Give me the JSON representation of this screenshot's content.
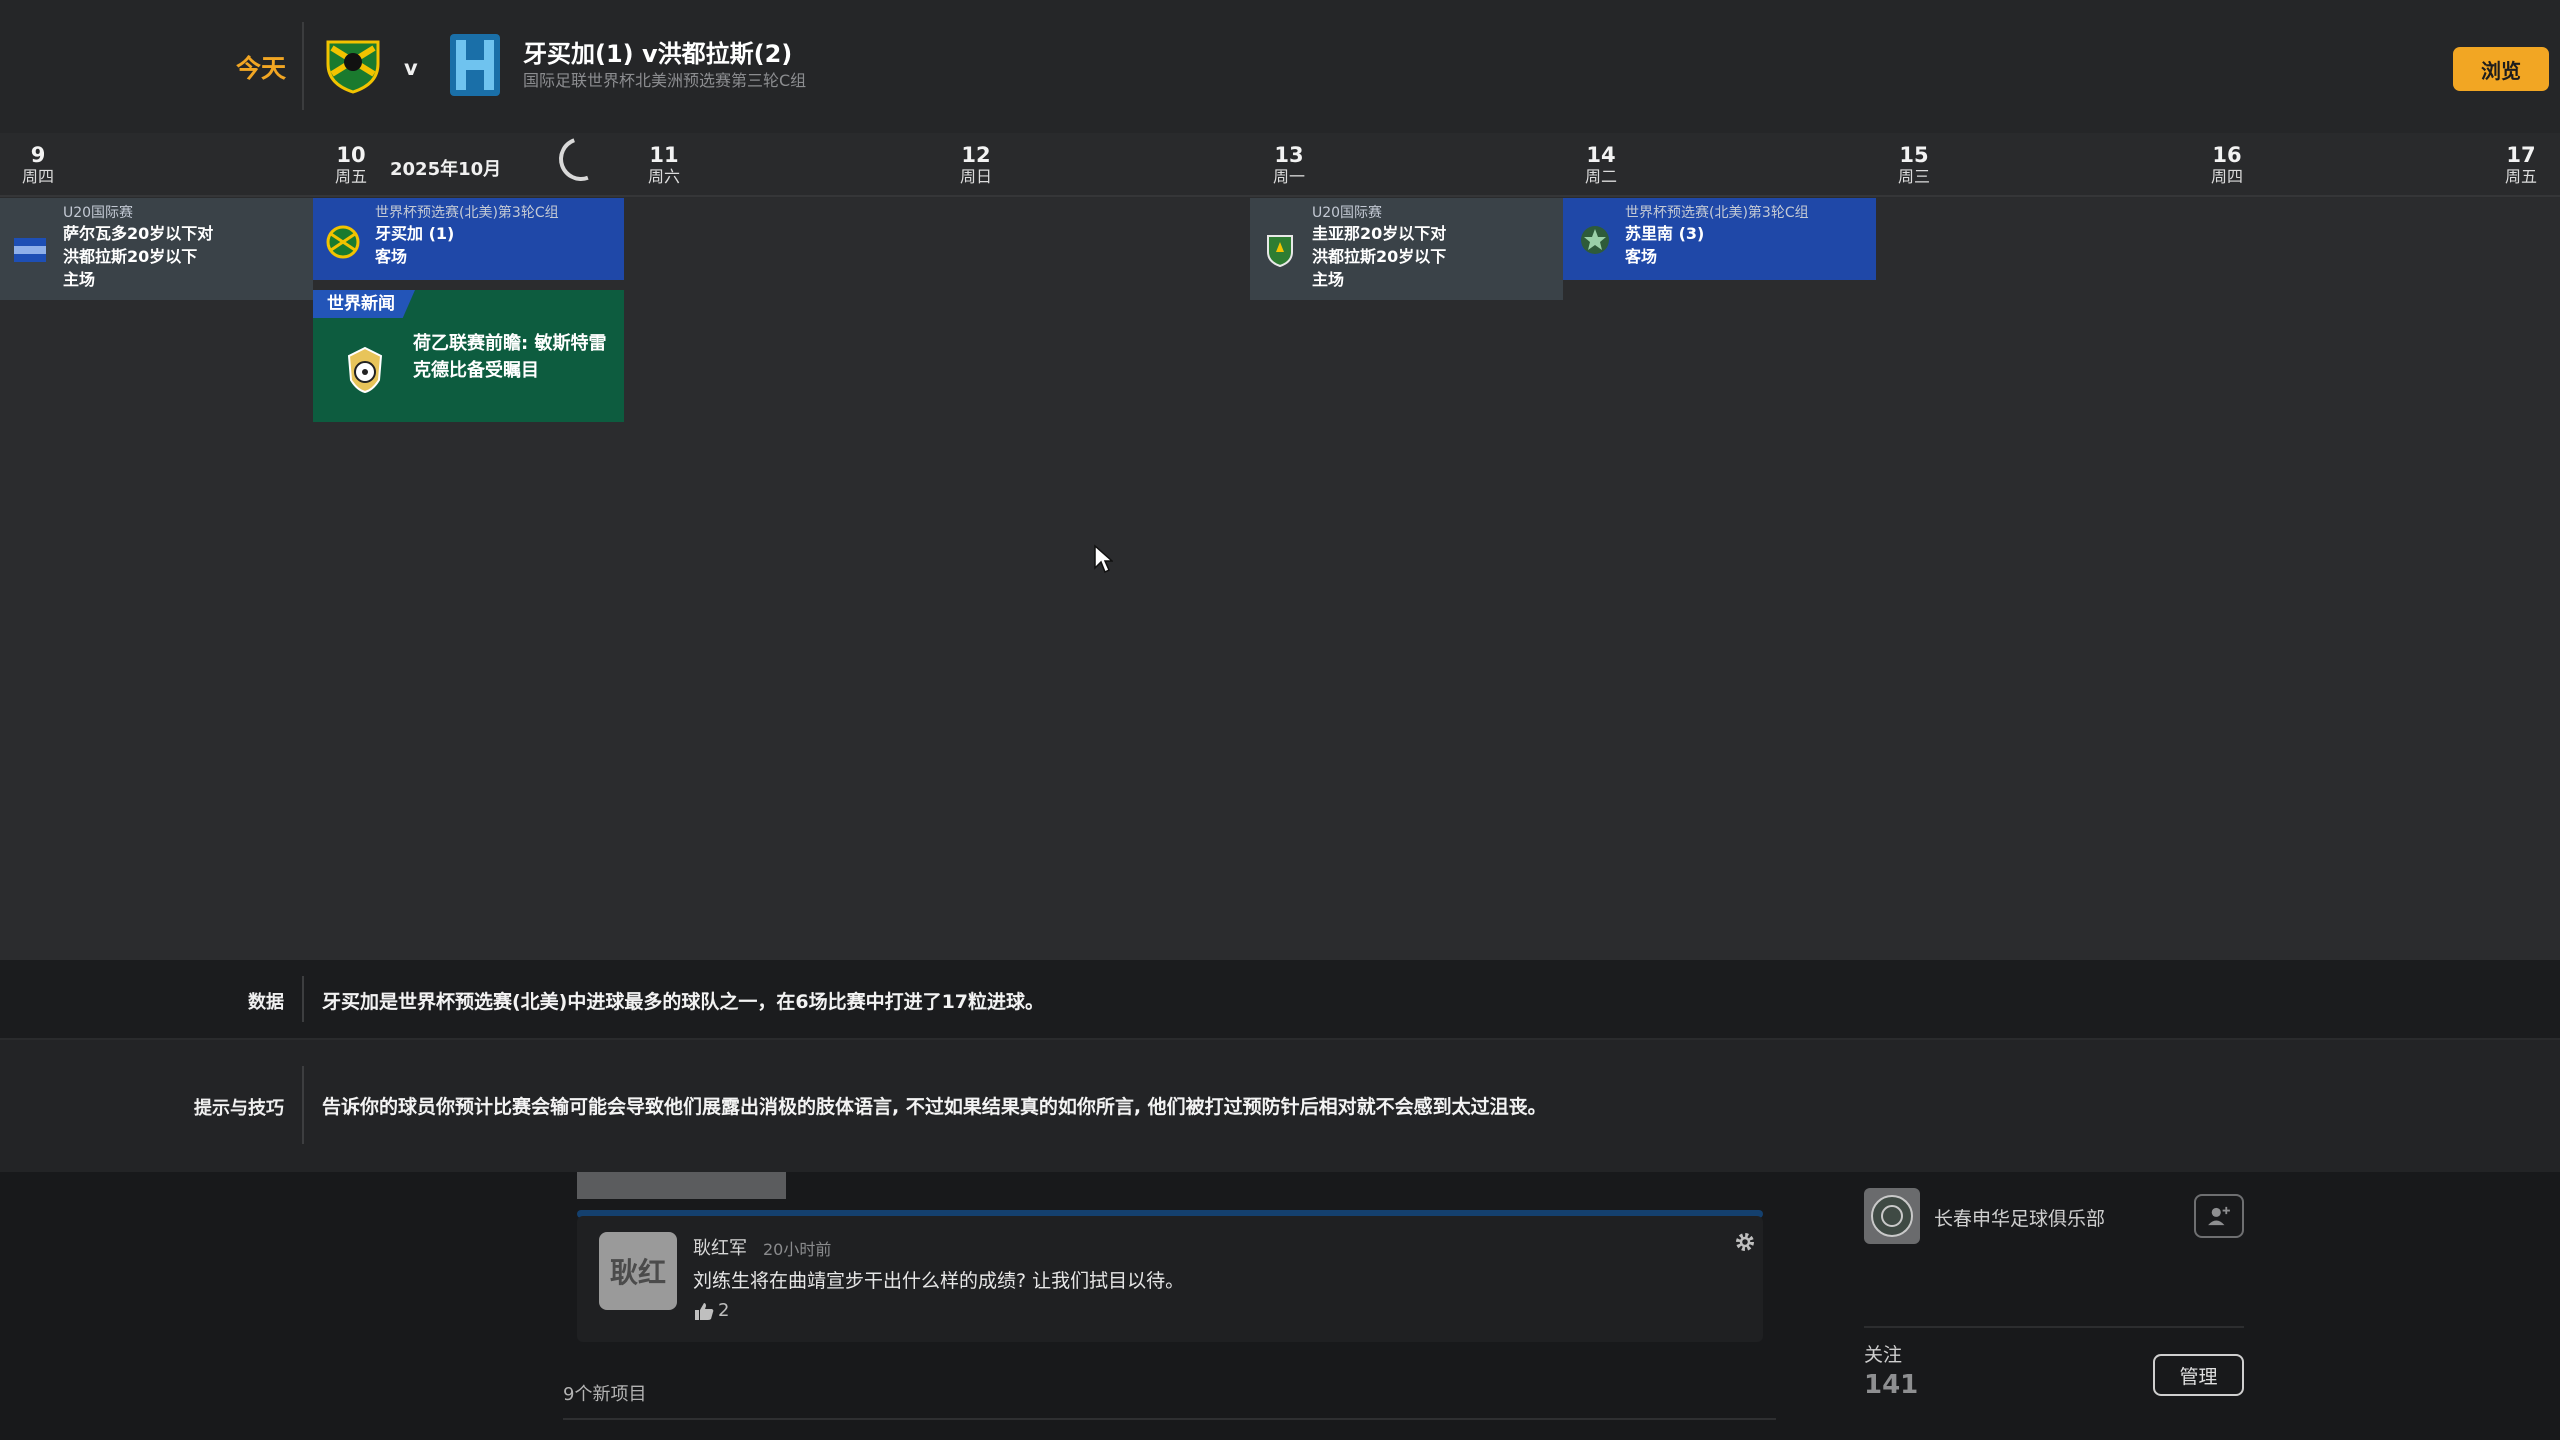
{
  "header": {
    "today_label": "今天",
    "vs": "v",
    "match_title": "牙买加(1) v洪都拉斯(2)",
    "match_subtitle": "国际足联世界杯北美洲预选赛第三轮C组",
    "browse_button": "浏览"
  },
  "calendar": {
    "month_label": "2025年10月",
    "days": [
      {
        "num": "9",
        "dow": "周四"
      },
      {
        "num": "10",
        "dow": "周五"
      },
      {
        "num": "11",
        "dow": "周六"
      },
      {
        "num": "12",
        "dow": "周日"
      },
      {
        "num": "13",
        "dow": "周一"
      },
      {
        "num": "14",
        "dow": "周二"
      },
      {
        "num": "15",
        "dow": "周三"
      },
      {
        "num": "16",
        "dow": "周四"
      },
      {
        "num": "17",
        "dow": "周五"
      }
    ],
    "events": {
      "e9": {
        "competition": "U20国际赛",
        "line1": "萨尔瓦多20岁以下对",
        "line2": "洪都拉斯20岁以下",
        "line3": "主场"
      },
      "e10": {
        "competition": "世界杯预选赛(北美)第3轮C组",
        "line1": "牙买加 (1)",
        "line2": "客场"
      },
      "e13": {
        "competition": "U20国际赛",
        "line1": "圭亚那20岁以下对",
        "line2": "洪都拉斯20岁以下",
        "line3": "主场"
      },
      "e14": {
        "competition": "世界杯预选赛(北美)第3轮C组",
        "line1": "苏里南 (3)",
        "line2": "客场"
      }
    },
    "news": {
      "tag": "世界新闻",
      "title": "荷乙联赛前瞻: 敏斯特雷克德比备受瞩目"
    }
  },
  "info": {
    "stats_label": "数据",
    "stats_text": "牙买加是世界杯预选赛(北美)中进球最多的球队之一，在6场比赛中打进了17粒进球。",
    "tips_label": "提示与技巧",
    "tips_text": "告诉你的球员你预计比赛会输可能会导致他们展露出消极的肢体语言, 不过如果结果真的如你所言, 他们被打过预防针后相对就不会感到太过沮丧。"
  },
  "feed": {
    "comment": {
      "avatar_text": "耿红",
      "author": "耿红军",
      "time": "20小时前",
      "text": "刘练生将在曲靖宣步干出什么样的成绩? 让我们拭目以待。",
      "likes": "2"
    },
    "new_items": "9个新项目"
  },
  "sidebar": {
    "club_name": "长春申华足球俱乐部",
    "follow_label": "关注",
    "follow_count": "141",
    "manage_button": "管理"
  },
  "colors": {
    "accent": "#f2a623",
    "event_blue": "#1f48a8",
    "event_grey": "#3a4248",
    "news_green": "#0d5c3f"
  }
}
